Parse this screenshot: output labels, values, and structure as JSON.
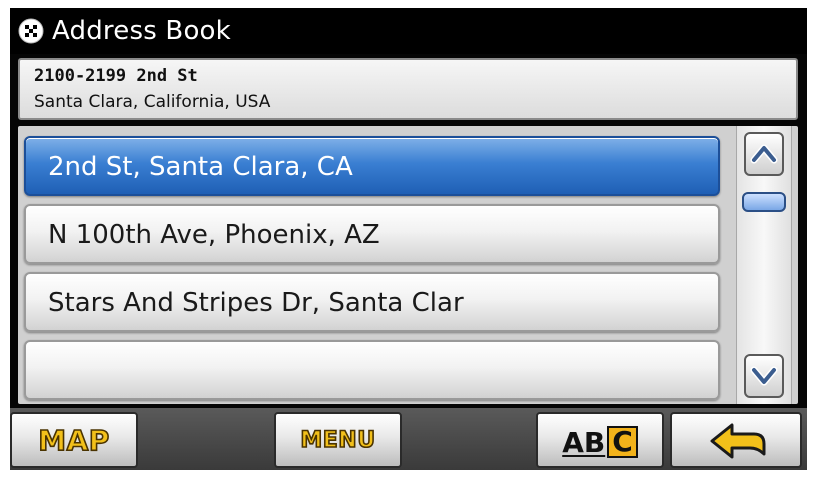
{
  "window": {
    "title": "Address Book",
    "icon": "checkered-flag-icon"
  },
  "selected_address": {
    "line1": "2100-2199 2nd St",
    "line2": "Santa Clara, California, USA"
  },
  "list": {
    "items": [
      {
        "label": "2nd St, Santa Clara, CA",
        "selected": true
      },
      {
        "label": "N 100th Ave, Phoenix, AZ",
        "selected": false
      },
      {
        "label": "Stars And Stripes Dr, Santa Clar",
        "selected": false
      },
      {
        "label": "",
        "selected": false
      }
    ]
  },
  "scrollbar": {
    "up_icon": "chevron-up-icon",
    "down_icon": "chevron-down-icon"
  },
  "toolbar": {
    "map_label": "MAP",
    "menu_label": "MENU",
    "abc_part1": "AB",
    "abc_part2": "C",
    "back_icon": "back-arrow-icon"
  },
  "colors": {
    "selected_item": "#3a7fd2",
    "button_text_gold": "#f2c01a",
    "abc_highlight": "#f2b21a",
    "titlebar": "#000000"
  }
}
